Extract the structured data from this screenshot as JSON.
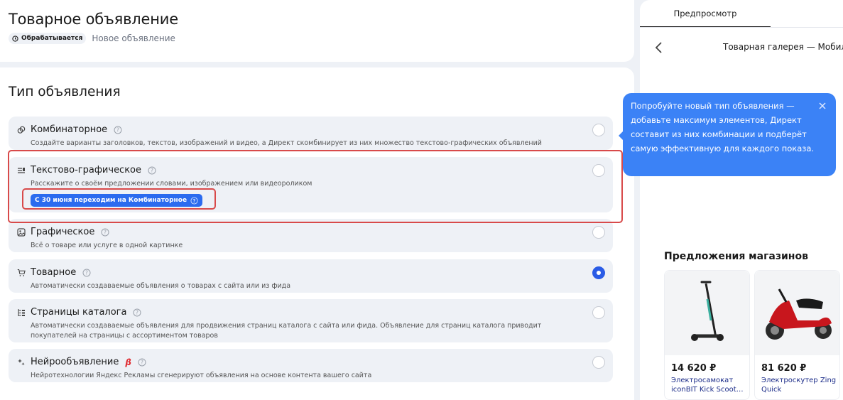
{
  "header": {
    "title": "Товарное объявление",
    "status_badge": "Обрабатывается",
    "status_sub": "Новое объявление"
  },
  "section": {
    "title": "Тип объявления"
  },
  "options": [
    {
      "title": "Комбинаторное",
      "desc": "Создайте варианты заголовков, текстов, изображений и видео, а Директ скомбинирует из них множество текстово-графических объявлений",
      "selected": false
    },
    {
      "title": "Текстово-графическое",
      "desc": "Расскажите о своём предложении словами, изображением или видеороликом",
      "notice": "С 30 июня переходим на Комбинаторное",
      "selected": false
    },
    {
      "title": "Графическое",
      "desc": "Всё о товаре или услуге в одной картинке",
      "selected": false
    },
    {
      "title": "Товарное",
      "desc": "Автоматически создаваемые объявления о товарах с сайта или из фида",
      "selected": true
    },
    {
      "title": "Страницы каталога",
      "desc": "Автоматически создаваемые объявления для продвижения страниц каталога с сайта или фида. Объявление для страниц каталога приводит покупателей на страницы с ассортиментом товаров",
      "selected": false
    },
    {
      "title": "Нейрообъявление",
      "beta": "β",
      "desc": "Нейротехнологии Яндекс Рекламы сгенерируют объявления на основе контента вашего сайта",
      "selected": false
    }
  ],
  "preview": {
    "tab": "Предпросмотр",
    "gallery_title": "Товарная галерея — Мобил",
    "shop_title": "Предложения магазинов",
    "products": [
      {
        "price": "14 620 ₽",
        "name": "Электросамокат iconBIT Kick Scoot…"
      },
      {
        "price": "81 620 ₽",
        "name": "Электроскутер Zing Quick"
      }
    ]
  },
  "tooltip": {
    "text": "Попробуйте новый тип объявления — добавьте максимум элементов, Директ составит из них комбинации и подберёт самую эффективную для каждого показа."
  },
  "colors": {
    "accent": "#2b5ce6",
    "tooltip": "#3b82f6",
    "highlight": "#d84a4a",
    "beta": "#e0282e"
  }
}
